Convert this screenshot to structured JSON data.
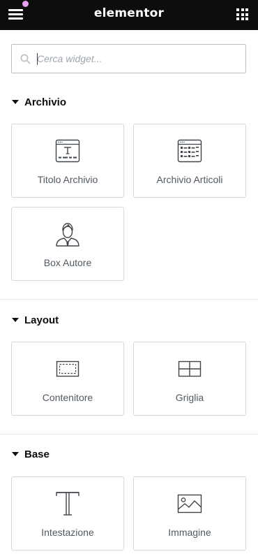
{
  "topbar": {
    "logo": "elementor",
    "colors": {
      "bar": "#0c0d0e",
      "notification_dot": "#e6a1f0"
    }
  },
  "search": {
    "placeholder": "Cerca widget..."
  },
  "categories": [
    {
      "label": "Archivio",
      "widgets": [
        {
          "label": "Titolo Archivio",
          "icon": "archive-title-icon"
        },
        {
          "label": "Archivio Articoli",
          "icon": "archive-posts-icon"
        },
        {
          "label": "Box Autore",
          "icon": "author-box-icon"
        }
      ]
    },
    {
      "label": "Layout",
      "widgets": [
        {
          "label": "Contenitore",
          "icon": "container-icon"
        },
        {
          "label": "Griglia",
          "icon": "grid-icon"
        }
      ]
    },
    {
      "label": "Base",
      "widgets": [
        {
          "label": "Intestazione",
          "icon": "heading-icon"
        },
        {
          "label": "Immagine",
          "icon": "image-icon"
        }
      ]
    }
  ]
}
